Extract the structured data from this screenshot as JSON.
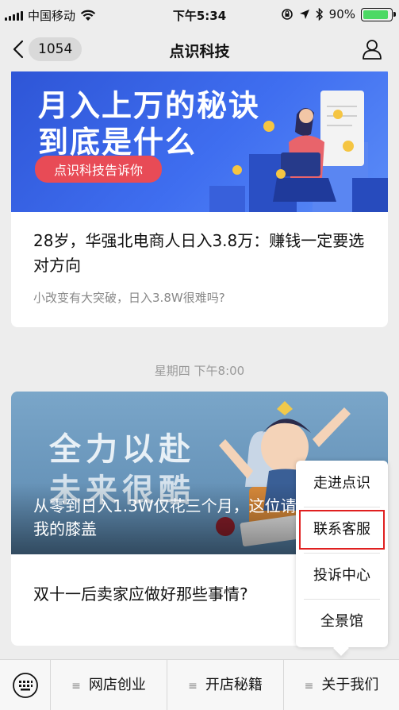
{
  "status_bar": {
    "carrier": "中国移动",
    "time": "下午5:34",
    "battery_percent": "90%",
    "battery_level": 0.9
  },
  "nav": {
    "title": "点识科技",
    "back_count": "1054"
  },
  "articles": [
    {
      "banner_line1": "月入上万的秘诀",
      "banner_line2": "到底是什么",
      "banner_tag": "点识科技告诉你",
      "title": "28岁，华强北电商人日入3.8万：赚钱一定要选对方向",
      "subtitle": "小改变有大突破，日入3.8W很难吗?"
    },
    {
      "banner_line1": "全力以赴",
      "banner_line2": "未来很酷",
      "banner_title": "从零到日入1.3W仅花三个月，这位请收下我的膝盖",
      "title": "双十一后卖家应做好那些事情?"
    }
  ],
  "timestamp": "星期四 下午8:00",
  "popup_menu": [
    "走进点识",
    "联系客服",
    "投诉中心",
    "全景馆"
  ],
  "bottom_menu": [
    "网店创业",
    "开店秘籍",
    "关于我们"
  ],
  "colors": {
    "accent_red": "#e02020",
    "battery_green": "#4cd964",
    "banner_blue": "#3f6ef0"
  }
}
